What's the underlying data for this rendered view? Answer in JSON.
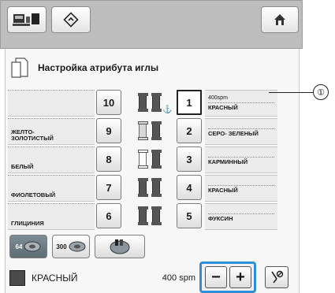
{
  "header": {
    "title": "Настройка атрибута иглы",
    "home_icon": "home-icon",
    "left_icons": [
      "machine-icon",
      "diamond-arrow-icon"
    ]
  },
  "rows": [
    {
      "left_label": "",
      "left_number": "10",
      "spools": [
        "dark",
        "dark"
      ],
      "anchor": "⚓",
      "right_number": "1",
      "right_top": "400spm",
      "right_bottom": "КРАСНЫЙ",
      "selected": true
    },
    {
      "left_label": "ЖЕЛТО-\nЗОЛОТИСТЫЙ",
      "left_number": "9",
      "spools": [
        "light",
        "dark"
      ],
      "anchor": "",
      "right_number": "2",
      "right_top": "",
      "right_bottom": "СЕРО- ЗЕЛЕНЫЙ",
      "selected": false
    },
    {
      "left_label": "БЕЛЫЙ",
      "left_number": "8",
      "spools": [
        "white",
        "dark"
      ],
      "anchor": "",
      "right_number": "3",
      "right_top": "",
      "right_bottom": "КАРМИННЫЙ",
      "selected": false
    },
    {
      "left_label": "ФИОЛЕТОВЫЙ",
      "left_number": "7",
      "spools": [
        "dark",
        "dark"
      ],
      "anchor": "",
      "right_number": "4",
      "right_top": "",
      "right_bottom": "КРАСНЫЙ",
      "selected": false
    },
    {
      "left_label": "ГЛИЦИНИЯ",
      "left_number": "6",
      "spools": [
        "dark",
        "dark"
      ],
      "anchor": "",
      "right_number": "5",
      "right_top": "",
      "right_bottom": "ФУКСИН",
      "selected": false
    }
  ],
  "bottom_buttons": [
    {
      "label": "64",
      "icon": "spool-icon",
      "active": true
    },
    {
      "label": "300",
      "icon": "spool-icon",
      "active": false
    },
    {
      "label": "",
      "icon": "palette-icon",
      "active": false
    }
  ],
  "status": {
    "color_name": "КРАСНЫЙ",
    "speed": "400 spm",
    "swatch_color": "#4a4a4a"
  },
  "controls": {
    "minus_label": "−",
    "plus_label": "+",
    "thread_cut_icon": "thread-cut-icon"
  },
  "annotation": "①",
  "colors": {
    "toolbar": "#bdbdbd",
    "highlight": "#2c8fd8"
  }
}
